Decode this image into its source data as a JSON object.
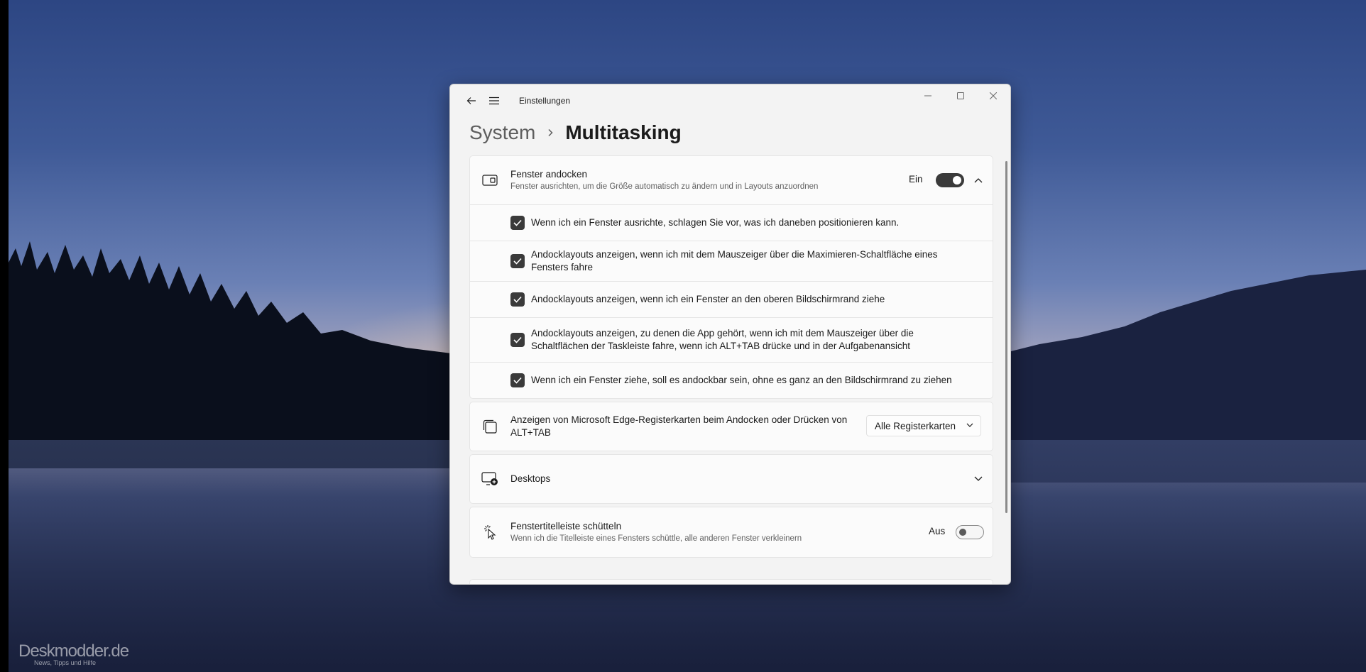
{
  "app": {
    "title": "Einstellungen"
  },
  "breadcrumb": {
    "parent": "System",
    "current": "Multitasking"
  },
  "snap": {
    "title": "Fenster andocken",
    "description": "Fenster ausrichten, um die Größe automatisch zu ändern und in Layouts anzuordnen",
    "state_label": "Ein",
    "toggle_on": true,
    "expanded": true,
    "options": [
      {
        "label": "Wenn ich ein Fenster ausrichte, schlagen Sie vor, was ich daneben positionieren kann.",
        "checked": true
      },
      {
        "label": "Andocklayouts anzeigen, wenn ich mit dem Mauszeiger über die Maximieren-Schaltfläche eines Fensters fahre",
        "checked": true
      },
      {
        "label": "Andocklayouts anzeigen, wenn ich ein Fenster an den oberen Bildschirmrand ziehe",
        "checked": true
      },
      {
        "label": "Andocklayouts anzeigen, zu denen die App gehört, wenn ich mit dem Mauszeiger über die Schaltflächen der Taskleiste fahre, wenn ich ALT+TAB drücke und in der Aufgabenansicht",
        "checked": true
      },
      {
        "label": "Wenn ich ein Fenster ziehe, soll es andockbar sein, ohne es ganz an den Bildschirmrand zu ziehen",
        "checked": true
      }
    ]
  },
  "edge_tabs": {
    "title": "Anzeigen von Microsoft Edge-Registerkarten beim Andocken oder Drücken von ALT+TAB",
    "selected": "Alle Registerkarten"
  },
  "desktops": {
    "title": "Desktops"
  },
  "shake": {
    "title": "Fenstertitelleiste schütteln",
    "description": "Wenn ich die Titelleiste eines Fensters schüttle, alle anderen Fenster verkleinern",
    "state_label": "Aus",
    "toggle_on": false
  },
  "watermark": {
    "name": "Deskmodder.de",
    "tagline": "News, Tipps und Hilfe"
  },
  "icons": {
    "back": "back-arrow-icon",
    "menu": "hamburger-menu-icon",
    "minimize": "minimize-icon",
    "maximize": "maximize-icon",
    "close": "close-icon",
    "snap": "snap-window-icon",
    "edge": "stacked-windows-icon",
    "desktops": "add-desktop-icon",
    "shake": "shake-cursor-icon"
  }
}
